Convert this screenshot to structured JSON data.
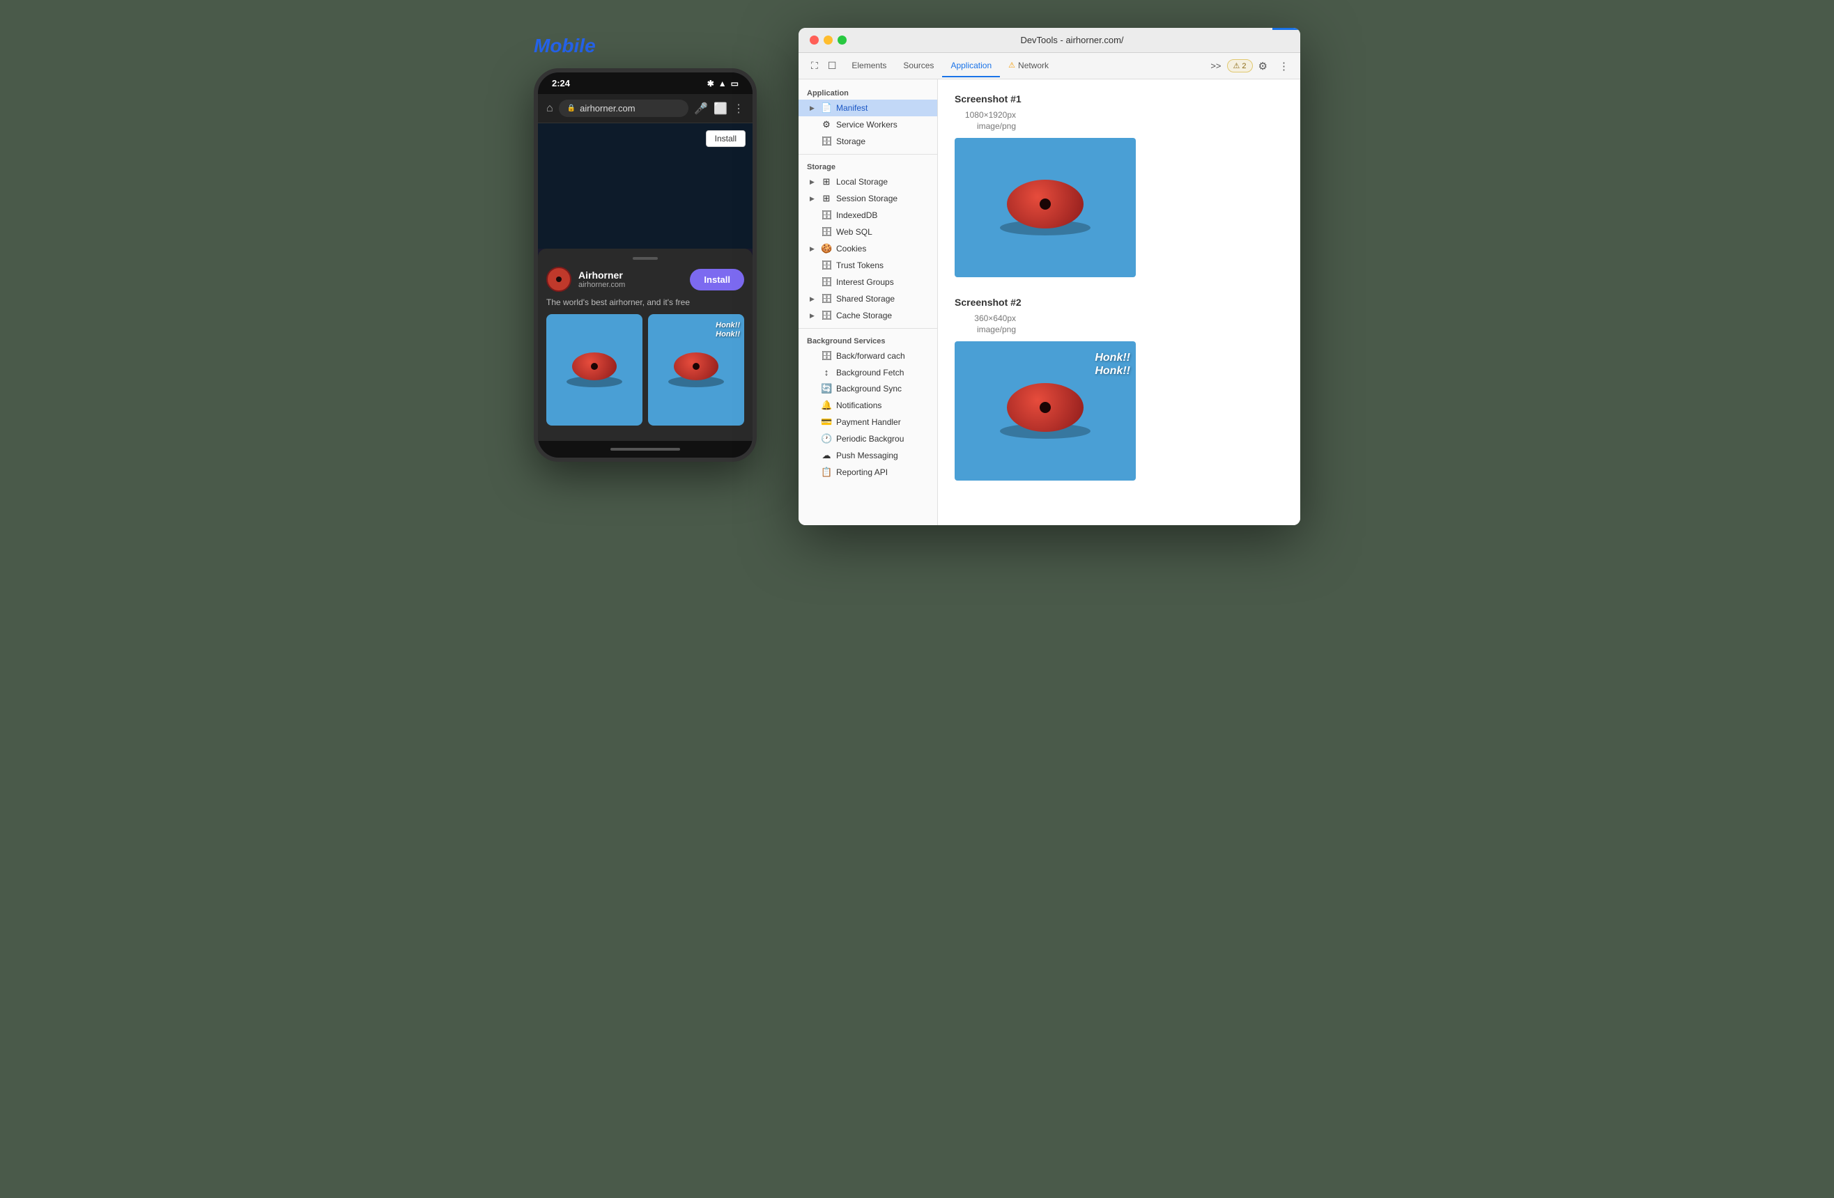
{
  "page": {
    "mobile_label": "Mobile"
  },
  "phone": {
    "status_time": "2:24",
    "url": "airhorner.com",
    "install_btn_top": "Install",
    "app_name": "Airhorner",
    "app_url": "airhorner.com",
    "install_btn_sheet": "Install",
    "description": "The world's best airhorner, and it's free",
    "screenshot1_honk": "",
    "screenshot2_honk": "Honk!!\nHonk!!"
  },
  "devtools": {
    "title": "DevTools - airhorner.com/",
    "tabs": [
      {
        "label": "Elements",
        "active": false
      },
      {
        "label": "Sources",
        "active": false
      },
      {
        "label": "Application",
        "active": true
      },
      {
        "label": "Network",
        "active": false,
        "warning": true
      }
    ],
    "badge_count": "⚠ 2",
    "sidebar": {
      "sections": [
        {
          "title": "Application",
          "items": [
            {
              "icon": "📄",
              "label": "Manifest",
              "expandable": true,
              "active": true
            },
            {
              "icon": "⚙",
              "label": "Service Workers",
              "expandable": false
            },
            {
              "icon": "🗄",
              "label": "Storage",
              "expandable": false
            }
          ]
        },
        {
          "title": "Storage",
          "items": [
            {
              "icon": "⊞",
              "label": "Local Storage",
              "expandable": true
            },
            {
              "icon": "⊞",
              "label": "Session Storage",
              "expandable": true
            },
            {
              "icon": "🗄",
              "label": "IndexedDB",
              "expandable": false
            },
            {
              "icon": "🗄",
              "label": "Web SQL",
              "expandable": false
            },
            {
              "icon": "🍪",
              "label": "Cookies",
              "expandable": true
            },
            {
              "icon": "🗄",
              "label": "Trust Tokens",
              "expandable": false
            },
            {
              "icon": "🗄",
              "label": "Interest Groups",
              "expandable": false
            },
            {
              "icon": "🗄",
              "label": "Shared Storage",
              "expandable": true
            },
            {
              "icon": "🗄",
              "label": "Cache Storage",
              "expandable": true
            }
          ]
        },
        {
          "title": "Background Services",
          "items": [
            {
              "icon": "🗄",
              "label": "Back/forward cache"
            },
            {
              "icon": "↕",
              "label": "Background Fetch"
            },
            {
              "icon": "🔄",
              "label": "Background Sync"
            },
            {
              "icon": "🔔",
              "label": "Notifications"
            },
            {
              "icon": "💳",
              "label": "Payment Handler"
            },
            {
              "icon": "🕐",
              "label": "Periodic Background"
            },
            {
              "icon": "☁",
              "label": "Push Messaging"
            },
            {
              "icon": "📋",
              "label": "Reporting API"
            }
          ]
        }
      ]
    },
    "main": {
      "screenshot1": {
        "title": "Screenshot #1",
        "dimensions": "1080×1920px",
        "type": "image/png",
        "has_honk": false
      },
      "screenshot2": {
        "title": "Screenshot #2",
        "dimensions": "360×640px",
        "type": "image/png",
        "has_honk": true
      }
    }
  }
}
